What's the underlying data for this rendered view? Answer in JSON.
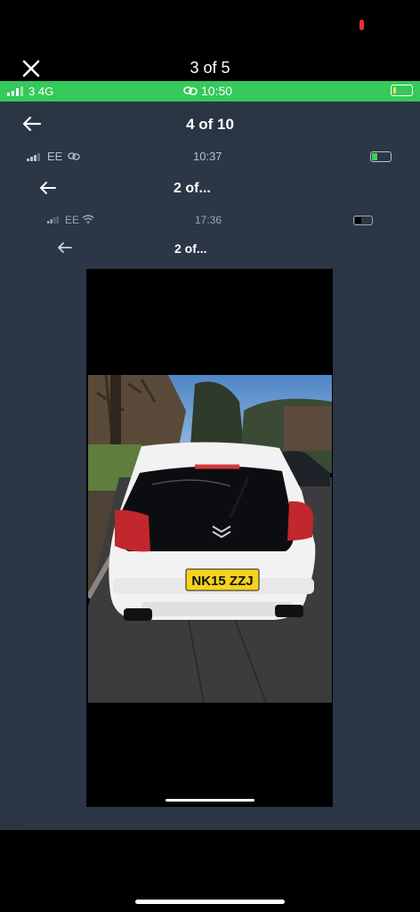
{
  "viewer": {
    "counter": "3 of 5"
  },
  "status_bar": {
    "carrier": "3  4G",
    "time": "10:50"
  },
  "screen1": {
    "title": "4 of 10"
  },
  "screen2": {
    "carrier": "EE",
    "time": "10:37",
    "title": "2 of..."
  },
  "screen3": {
    "carrier": "EE",
    "time": "17:36",
    "title": "2 of..."
  },
  "photo": {
    "plate": "NK15 ZZJ",
    "subject": "car-rear-photo"
  },
  "colors": {
    "green": "#35c85a",
    "panel": "#2a3544",
    "plate": "#f4d21f"
  }
}
